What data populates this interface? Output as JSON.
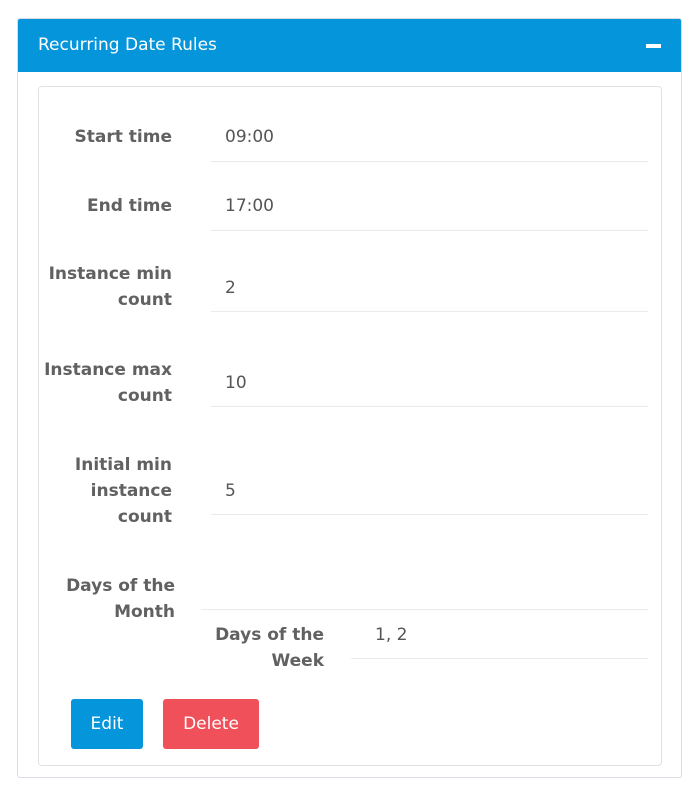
{
  "panel": {
    "title": "Recurring Date Rules"
  },
  "fields": [
    {
      "label": "Start time",
      "value": "09:00"
    },
    {
      "label": "End time",
      "value": "17:00"
    },
    {
      "label": "Instance min count",
      "value": "2"
    },
    {
      "label": "Instance max count",
      "value": "10"
    },
    {
      "label": "Initial min instance count",
      "value": "5"
    }
  ],
  "days_of_month": {
    "label": "Days of the Month",
    "days_of_week": {
      "label": "Days of the Week",
      "value": "1, 2"
    }
  },
  "actions": {
    "edit_label": "Edit",
    "delete_label": "Delete"
  }
}
